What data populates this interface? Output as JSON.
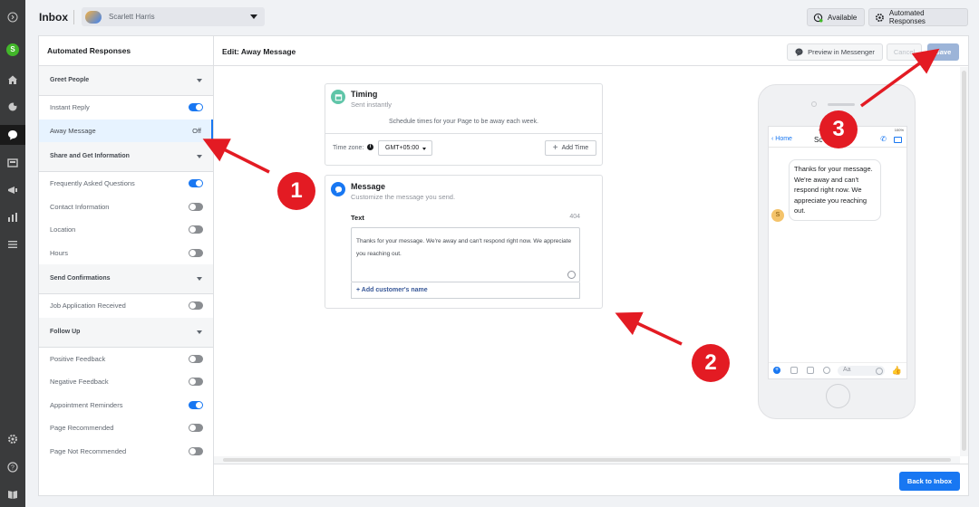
{
  "topbar": {
    "title": "Inbox",
    "page_name": "Scarlett Harris",
    "available_label": "Available",
    "automated_label": "Automated Responses"
  },
  "rail": {
    "avatar_letter": "S",
    "icons": [
      "expand-icon",
      "home-icon",
      "notifications-icon",
      "inbox-icon",
      "pages-icon",
      "ads-icon",
      "insights-icon",
      "menu-icon",
      "settings-icon",
      "help-icon",
      "book-icon"
    ]
  },
  "sidebar": {
    "title": "Automated Responses",
    "groups": [
      {
        "label": "Greet People",
        "items": [
          {
            "label": "Instant Reply",
            "toggle": "on"
          },
          {
            "label": "Away Message",
            "status": "Off",
            "active": true
          }
        ]
      },
      {
        "label": "Share and Get Information",
        "items": [
          {
            "label": "Frequently Asked Questions",
            "toggle": "on"
          },
          {
            "label": "Contact Information",
            "toggle": "off"
          },
          {
            "label": "Location",
            "toggle": "off"
          },
          {
            "label": "Hours",
            "toggle": "off"
          }
        ]
      },
      {
        "label": "Send Confirmations",
        "items": [
          {
            "label": "Job Application Received",
            "toggle": "off"
          }
        ]
      },
      {
        "label": "Follow Up",
        "items": [
          {
            "label": "Positive Feedback",
            "toggle": "off"
          },
          {
            "label": "Negative Feedback",
            "toggle": "off"
          },
          {
            "label": "Appointment Reminders",
            "toggle": "on"
          },
          {
            "label": "Page Recommended",
            "toggle": "off"
          },
          {
            "label": "Page Not Recommended",
            "toggle": "off"
          }
        ]
      }
    ]
  },
  "header": {
    "title": "Edit: Away Message",
    "preview_label": "Preview in Messenger",
    "cancel_label": "Cancel",
    "save_label": "Save"
  },
  "timing": {
    "title": "Timing",
    "subtitle": "Sent instantly",
    "schedule_text": "Schedule times for your Page to be away each week.",
    "timezone_label": "Time zone:",
    "timezone_value": "GMT+05:00",
    "add_time_label": "Add Time"
  },
  "message": {
    "title": "Message",
    "subtitle": "Customize the message you send.",
    "text_label": "Text",
    "char_count": "404",
    "text_value": "Thanks for your message. We're away and can't respond right now. We appreciate you reaching out.",
    "add_name_label": "+ Add customer's name"
  },
  "preview": {
    "back_label": "Home",
    "contact": "Sc",
    "time": "9:41",
    "battery": "100%",
    "bubble_text": "Thanks for your message. We're away and can't respond right now. We appreciate you reaching out.",
    "sender_letter": "S",
    "composer_placeholder": "Aa"
  },
  "footer": {
    "back_label": "Back to Inbox"
  },
  "annotations": [
    "1",
    "2",
    "3"
  ],
  "colors": {
    "accent": "#1877f2",
    "annotation": "#e31b23",
    "save_disabled": "#9cb4d8",
    "toggle_off": "#8a8d91"
  }
}
